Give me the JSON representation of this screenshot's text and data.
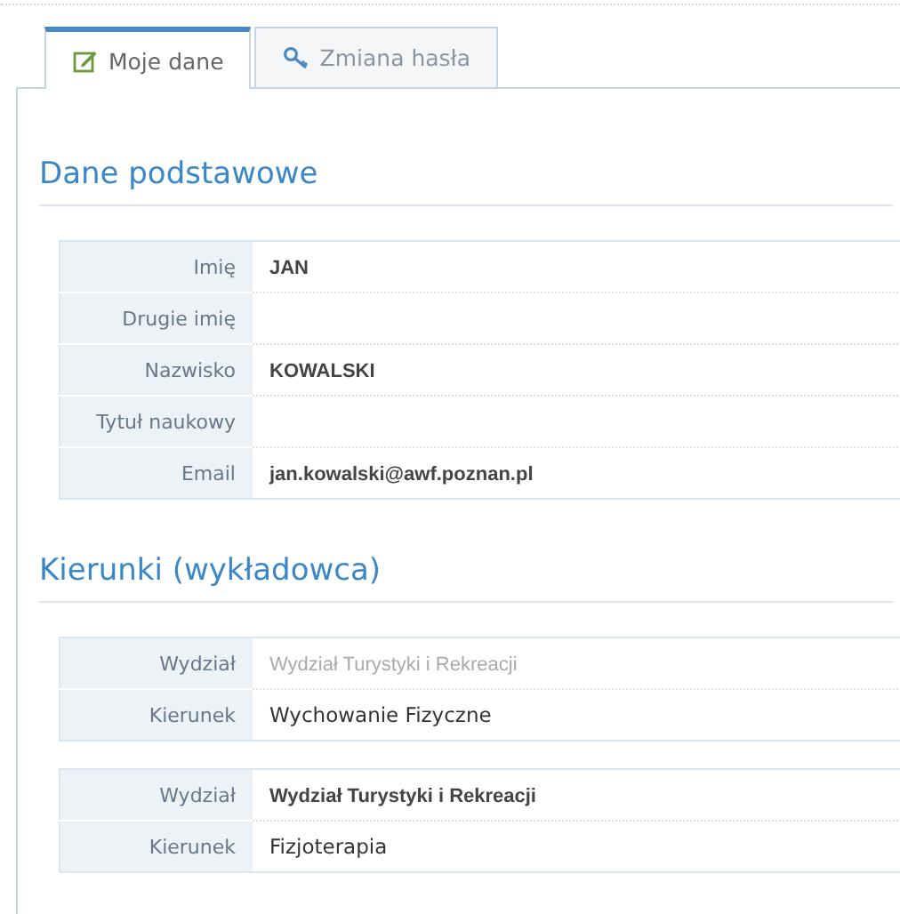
{
  "tabs": [
    {
      "label": "Moje dane",
      "kind": "edit",
      "selected": true
    },
    {
      "label": "Zmiana hasła",
      "kind": "key",
      "selected": false
    }
  ],
  "sections": [
    {
      "title": "Dane podstawowe",
      "tables": [
        {
          "rows": [
            {
              "label": "Imię",
              "value": "JAN",
              "kind": "bold"
            },
            {
              "label": "Drugie imię"
            },
            {
              "label": "Nazwisko",
              "value": "KOWALSKI",
              "kind": "bold"
            },
            {
              "label": "Tytuł naukowy"
            },
            {
              "label": "Email",
              "value": "jan.kowalski@awf.poznan.pl",
              "kind": "bold"
            }
          ]
        }
      ]
    },
    {
      "title": "Kierunki (wykładowca)",
      "tables": [
        {
          "rows": [
            {
              "label": "Wydział",
              "value": "Wydział Turystyki i Rekreacji",
              "kind": "muted"
            },
            {
              "label": "Kierunek",
              "value": "Wychowanie Fizyczne",
              "kind": "plain"
            }
          ]
        },
        {
          "rows": [
            {
              "label": "Wydział",
              "value": "Wydział Turystyki i Rekreacji",
              "kind": "bold"
            },
            {
              "label": "Kierunek",
              "value": "Fizjoterapia",
              "kind": "plain"
            }
          ]
        }
      ]
    }
  ]
}
